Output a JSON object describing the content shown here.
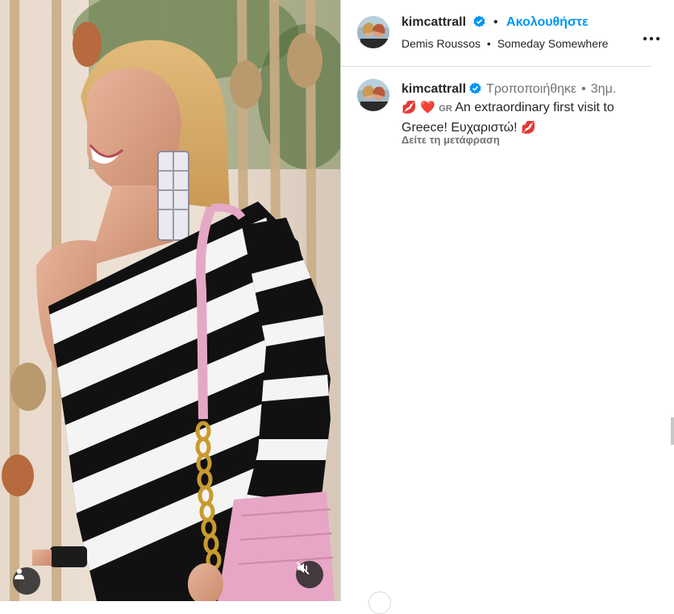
{
  "post": {
    "username": "kimcattrall",
    "follow_label": "Ακολουθήστε",
    "separator": "•",
    "audio_artist": "Demis Roussos",
    "audio_track": "Someday Somewhere",
    "more_icon": "more-options-icon"
  },
  "caption": {
    "username": "kimcattrall",
    "edited_label": "Τροποποιήθηκε",
    "separator": "•",
    "time_ago": "3ημ.",
    "emoji_lips": "💋",
    "emoji_heart": "❤️",
    "flag_code": "GR",
    "text": "An extraordinary first visit to Greece! Ευχαριστώ!",
    "emoji_lips_end": "💋",
    "translate_label": "Δείτε τη μετάφραση"
  },
  "media": {
    "tag_icon": "user-tag-icon",
    "mute_icon": "speaker-muted-icon"
  },
  "colors": {
    "accent": "#0095f6",
    "verified": "#0095f6",
    "text": "#262626",
    "secondary": "#737373",
    "divider": "#dbdbdb"
  }
}
